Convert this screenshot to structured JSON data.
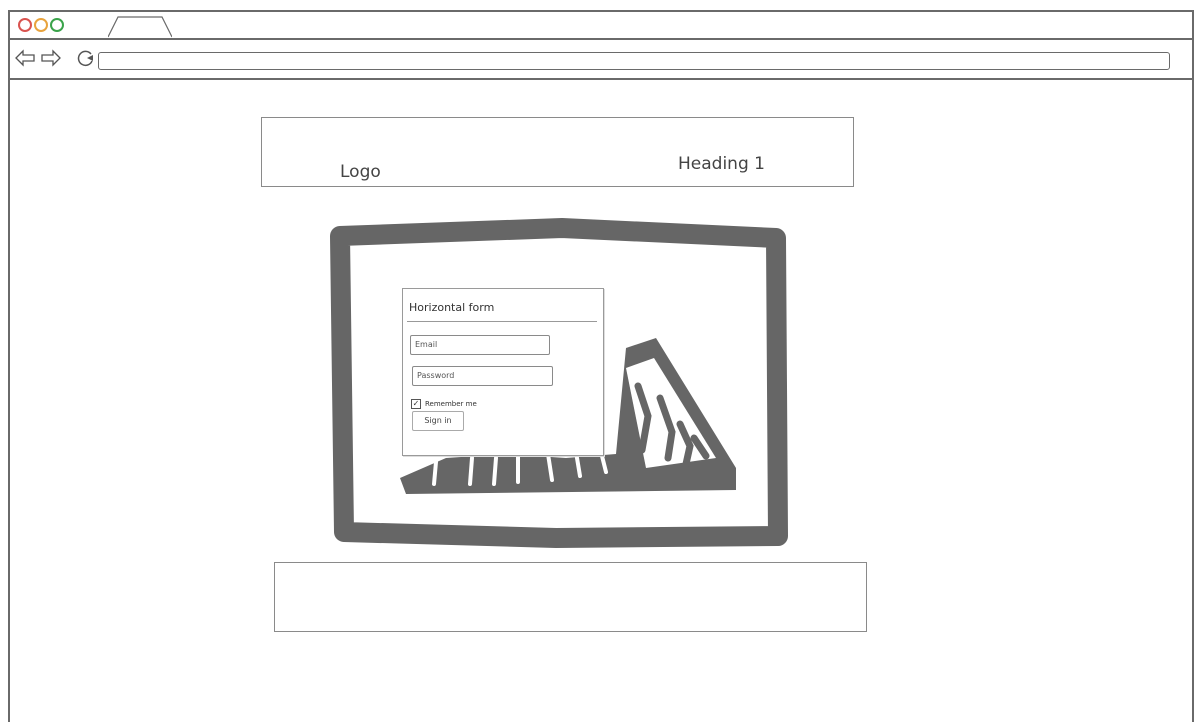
{
  "browser": {
    "window_controls": [
      "close",
      "minimize",
      "maximize"
    ],
    "nav_icons": [
      "back-arrow-icon",
      "forward-arrow-icon",
      "reload-icon"
    ],
    "url": ""
  },
  "header": {
    "logo": "Logo",
    "heading": "Heading 1"
  },
  "hero": {
    "image_placeholder": "image-placeholder-icon"
  },
  "login_form": {
    "title": "Horizontal form",
    "email_placeholder": "Email",
    "password_placeholder": "Password",
    "remember_label": "Remember me",
    "remember_checked": true,
    "submit_label": "Sign in"
  },
  "colors": {
    "chrome": "#6a6a6a",
    "close": "#d9534f",
    "minimize": "#e8a33d",
    "maximize": "#3aa34a",
    "placeholder": "#666666"
  }
}
